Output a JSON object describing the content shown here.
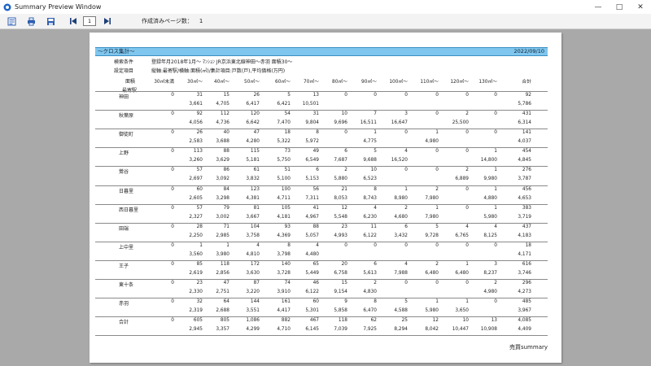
{
  "window": {
    "title": "Summary Preview Window"
  },
  "toolbar": {
    "page_input": "1",
    "page_count_label": "作成済みページ数：",
    "page_count_value": "1"
  },
  "report": {
    "title": "～クロス集計～",
    "date": "2022/09/10",
    "conditions": [
      {
        "label": "検索条件",
        "value": "登録年月2018年1月～ ﾏﾝｼｮﾝ JR京浜東北線神田～赤羽 面積30～"
      },
      {
        "label": "設定項目",
        "value": "縦軸:最寄駅/横軸:面積(㎡)/集計項目:戸数(戸),平均価格(万円)"
      }
    ],
    "axis_col_label": "面積",
    "axis_row_label": "最寄駅",
    "columns": [
      "30㎡未満",
      "30㎡～",
      "40㎡～",
      "50㎡～",
      "60㎡～",
      "70㎡～",
      "80㎡～",
      "90㎡～",
      "100㎡～",
      "110㎡～",
      "120㎡～",
      "130㎡～",
      "合計"
    ],
    "rows": [
      {
        "name": "神田",
        "counts": [
          "0",
          "31",
          "15",
          "26",
          "5",
          "13",
          "0",
          "0",
          "0",
          "0",
          "0",
          "0",
          "92"
        ],
        "prices": [
          "",
          "3,661",
          "4,705",
          "6,417",
          "6,421",
          "10,501",
          "",
          "",
          "",
          "",
          "",
          "",
          "5,786"
        ]
      },
      {
        "name": "秋葉原",
        "counts": [
          "0",
          "92",
          "112",
          "120",
          "54",
          "31",
          "10",
          "7",
          "3",
          "0",
          "2",
          "0",
          "431"
        ],
        "prices": [
          "",
          "4,056",
          "4,736",
          "6,642",
          "7,470",
          "9,804",
          "9,696",
          "16,511",
          "16,647",
          "",
          "25,500",
          "",
          "6,314"
        ]
      },
      {
        "name": "御徒町",
        "counts": [
          "0",
          "26",
          "40",
          "47",
          "18",
          "8",
          "0",
          "1",
          "0",
          "1",
          "0",
          "0",
          "141"
        ],
        "prices": [
          "",
          "2,583",
          "3,688",
          "4,280",
          "5,322",
          "5,972",
          "",
          "4,775",
          "",
          "4,980",
          "",
          "",
          "4,037"
        ]
      },
      {
        "name": "上野",
        "counts": [
          "0",
          "113",
          "88",
          "115",
          "73",
          "49",
          "6",
          "5",
          "4",
          "0",
          "0",
          "1",
          "454"
        ],
        "prices": [
          "",
          "3,260",
          "3,629",
          "5,181",
          "5,750",
          "6,549",
          "7,687",
          "9,688",
          "16,520",
          "",
          "",
          "14,800",
          "4,845"
        ]
      },
      {
        "name": "鶯谷",
        "counts": [
          "0",
          "57",
          "86",
          "61",
          "51",
          "6",
          "2",
          "10",
          "0",
          "0",
          "2",
          "1",
          "276"
        ],
        "prices": [
          "",
          "2,697",
          "3,092",
          "3,832",
          "5,100",
          "5,153",
          "5,880",
          "6,523",
          "",
          "",
          "6,889",
          "9,980",
          "3,787"
        ]
      },
      {
        "name": "日暮里",
        "counts": [
          "0",
          "60",
          "84",
          "123",
          "100",
          "56",
          "21",
          "8",
          "1",
          "2",
          "0",
          "1",
          "456"
        ],
        "prices": [
          "",
          "2,605",
          "3,298",
          "4,381",
          "4,711",
          "7,311",
          "8,053",
          "8,743",
          "8,980",
          "7,980",
          "",
          "4,880",
          "4,653"
        ]
      },
      {
        "name": "西日暮里",
        "counts": [
          "0",
          "57",
          "79",
          "81",
          "105",
          "41",
          "12",
          "4",
          "2",
          "1",
          "0",
          "1",
          "383"
        ],
        "prices": [
          "",
          "2,327",
          "3,002",
          "3,667",
          "4,181",
          "4,967",
          "5,548",
          "6,230",
          "4,680",
          "7,980",
          "",
          "5,980",
          "3,719"
        ]
      },
      {
        "name": "田端",
        "counts": [
          "0",
          "28",
          "71",
          "104",
          "93",
          "88",
          "23",
          "11",
          "6",
          "5",
          "4",
          "4",
          "437"
        ],
        "prices": [
          "",
          "2,250",
          "2,985",
          "3,758",
          "4,369",
          "5,057",
          "4,993",
          "6,122",
          "3,432",
          "9,728",
          "6,765",
          "8,125",
          "4,183"
        ]
      },
      {
        "name": "上中里",
        "counts": [
          "0",
          "1",
          "1",
          "4",
          "8",
          "4",
          "0",
          "0",
          "0",
          "0",
          "0",
          "0",
          "18"
        ],
        "prices": [
          "",
          "3,560",
          "3,980",
          "4,810",
          "3,798",
          "4,480",
          "",
          "",
          "",
          "",
          "",
          "",
          "4,171"
        ]
      },
      {
        "name": "王子",
        "counts": [
          "0",
          "85",
          "118",
          "172",
          "140",
          "65",
          "20",
          "6",
          "4",
          "2",
          "1",
          "3",
          "616"
        ],
        "prices": [
          "",
          "2,619",
          "2,856",
          "3,630",
          "3,728",
          "5,449",
          "6,758",
          "5,613",
          "7,988",
          "6,480",
          "6,480",
          "8,237",
          "3,746"
        ]
      },
      {
        "name": "東十条",
        "counts": [
          "0",
          "23",
          "47",
          "87",
          "74",
          "46",
          "15",
          "2",
          "0",
          "0",
          "0",
          "2",
          "296"
        ],
        "prices": [
          "",
          "2,330",
          "2,751",
          "3,220",
          "3,910",
          "6,122",
          "9,154",
          "4,830",
          "",
          "",
          "",
          "4,980",
          "4,273"
        ]
      },
      {
        "name": "赤羽",
        "counts": [
          "0",
          "32",
          "64",
          "144",
          "161",
          "60",
          "9",
          "8",
          "5",
          "1",
          "1",
          "0",
          "485"
        ],
        "prices": [
          "",
          "2,319",
          "2,688",
          "3,551",
          "4,417",
          "5,301",
          "5,858",
          "6,470",
          "4,588",
          "5,980",
          "3,650",
          "",
          "3,967"
        ]
      },
      {
        "name": "合計",
        "counts": [
          "0",
          "605",
          "805",
          "1,086",
          "882",
          "467",
          "118",
          "62",
          "25",
          "12",
          "10",
          "13",
          "4,085"
        ],
        "prices": [
          "",
          "2,945",
          "3,357",
          "4,299",
          "4,710",
          "6,145",
          "7,039",
          "7,925",
          "8,294",
          "8,042",
          "10,447",
          "10,908",
          "4,409"
        ]
      }
    ],
    "footer": "売買summary"
  }
}
